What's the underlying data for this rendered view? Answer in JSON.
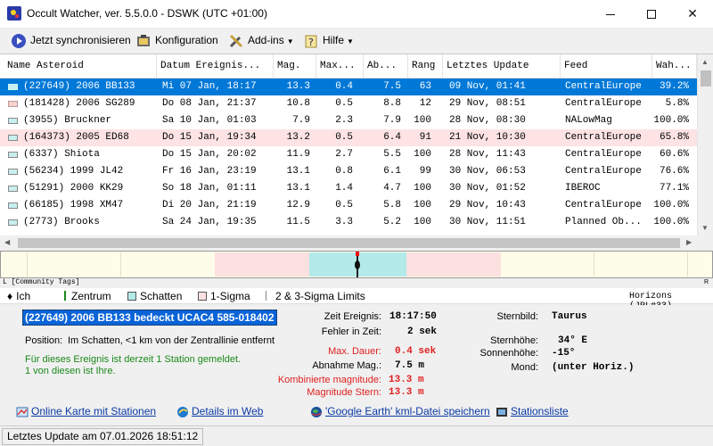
{
  "window": {
    "title": "Occult Watcher, ver. 5.5.0.0 - DSWK (UTC +01:00)",
    "minimize": "—",
    "maximize": "☐",
    "close": "✕"
  },
  "toolbar": {
    "sync": "Jetzt synchronisieren",
    "config": "Konfiguration",
    "addins": "Add-ins",
    "help": "Hilfe"
  },
  "grid": {
    "columns": [
      "Name Asteroid",
      "Datum Ereignis...",
      "Mag.",
      "Max...",
      "Ab...",
      "Rang",
      "Letztes Update",
      "Feed",
      "Wah..."
    ],
    "rows": [
      {
        "name": "(227649) 2006 BB133",
        "date": "Mi 07 Jan, 18:17",
        "mag": "13.3",
        "max": "0.4",
        "ab": "7.5",
        "rang": "63",
        "update": "09 Nov, 01:41",
        "feed": "CentralEurope",
        "wah": "39.2%"
      },
      {
        "name": "(181428) 2006 SG289",
        "date": "Do 08 Jan, 21:37",
        "mag": "10.8",
        "max": "0.5",
        "ab": "8.8",
        "rang": "12",
        "update": "29 Nov, 08:51",
        "feed": "CentralEurope",
        "wah": "5.8%"
      },
      {
        "name": "(3955) Bruckner",
        "date": "Sa 10 Jan, 01:03",
        "mag": "7.9",
        "max": "2.3",
        "ab": "7.9",
        "rang": "100",
        "update": "28 Nov, 08:30",
        "feed": "NALowMag",
        "wah": "100.0%"
      },
      {
        "name": "(164373) 2005 ED68",
        "date": "Do 15 Jan, 19:34",
        "mag": "13.2",
        "max": "0.5",
        "ab": "6.4",
        "rang": "91",
        "update": "21 Nov, 10:30",
        "feed": "CentralEurope",
        "wah": "65.8%"
      },
      {
        "name": "(6337) Shiota",
        "date": "Do 15 Jan, 20:02",
        "mag": "11.9",
        "max": "2.7",
        "ab": "5.5",
        "rang": "100",
        "update": "28 Nov, 11:43",
        "feed": "CentralEurope",
        "wah": "60.6%"
      },
      {
        "name": "(56234) 1999 JL42",
        "date": "Fr 16 Jan, 23:19",
        "mag": "13.1",
        "max": "0.8",
        "ab": "6.1",
        "rang": "99",
        "update": "30 Nov, 06:53",
        "feed": "CentralEurope",
        "wah": "76.6%"
      },
      {
        "name": "(51291) 2000 KK29",
        "date": "So 18 Jan, 01:11",
        "mag": "13.1",
        "max": "1.4",
        "ab": "4.7",
        "rang": "100",
        "update": "30 Nov, 01:52",
        "feed": "IBEROC",
        "wah": "77.1%"
      },
      {
        "name": "(66185) 1998 XM47",
        "date": "Di 20 Jan, 21:19",
        "mag": "12.9",
        "max": "0.5",
        "ab": "5.8",
        "rang": "100",
        "update": "29 Nov, 10:43",
        "feed": "CentralEurope",
        "wah": "100.0%"
      },
      {
        "name": "(2773) Brooks",
        "date": "Sa 24 Jan, 19:35",
        "mag": "11.5",
        "max": "3.3",
        "ab": "5.2",
        "rang": "100",
        "update": "30 Nov, 11:51",
        "feed": "Planned Ob...",
        "wah": "100.0%"
      }
    ]
  },
  "visual": {
    "community_tags": "L [Community Tags]",
    "edge_right": "R"
  },
  "legend": {
    "ich": "Ich",
    "zentrum": "Zentrum",
    "schatten": "Schatten",
    "sigma1": "1-Sigma",
    "sigma23": "2 & 3-Sigma Limits",
    "horizons": "Horizons (JPL#33)"
  },
  "event": {
    "title": "(227649) 2006 BB133 bedeckt UCAC4 585-018402",
    "position_label": "Position:",
    "position_value": "Im Schatten, <1 km von der Zentrallinie entfernt",
    "stations_line1": "Für dieses Ereignis ist derzeit 1 Station gemeldet.",
    "stations_line2": "1 von diesen ist Ihre.",
    "zeit_label": "Zeit Ereignis:",
    "zeit_value": "18:17:50",
    "fehler_label": "Fehler in Zeit:",
    "fehler_value": "2 sek",
    "dauer_label": "Max. Dauer:",
    "dauer_value": "0.4 sek",
    "abnahme_label": "Abnahme Mag.:",
    "abnahme_value": "7.5 m",
    "komb_label": "Kombinierte magnitude:",
    "komb_value": "13.3 m",
    "magstern_label": "Magnitude Stern:",
    "magstern_value": "13.3 m",
    "sternbild_label": "Sternbild:",
    "sternbild_value": "Taurus",
    "sternhoehe_label": "Sternhöhe:",
    "sternhoehe_value": "34° E",
    "sonnenhoehe_label": "Sonnenhöhe:",
    "sonnenhoehe_value": "-15°",
    "mond_label": "Mond:",
    "mond_value": "(unter Horiz.)"
  },
  "links": {
    "karte": "Online Karte mit Stationen",
    "details": "Details im Web",
    "kml": "'Google Earth' kml-Datei speichern",
    "stationsliste": "Stationsliste"
  },
  "status": {
    "text": "Letztes Update am 07.01.2026 18:51:12"
  },
  "colors": {
    "selection": "#0078d7",
    "shadow_band": "#b4eaea",
    "sigma_band": "#fde0e0",
    "link": "#0a3aa5",
    "green_text": "#1a8a1a",
    "red_text": "#e02020"
  }
}
